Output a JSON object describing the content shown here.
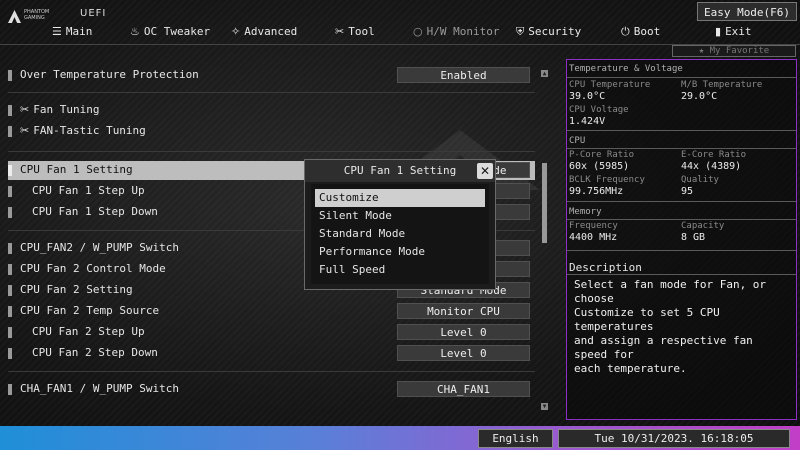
{
  "header": {
    "logo_text": "PHANTOM GAMING",
    "uefi": "UEFI",
    "easy_mode": "Easy Mode(F6)"
  },
  "nav": [
    {
      "label": "Main",
      "icon": "list-icon",
      "glyph": "☰"
    },
    {
      "label": "OC Tweaker",
      "icon": "flame-icon",
      "glyph": "♨"
    },
    {
      "label": "Advanced",
      "icon": "star-icon",
      "glyph": "✧"
    },
    {
      "label": "Tool",
      "icon": "tools-icon",
      "glyph": "✂"
    },
    {
      "label": "H/W Monitor",
      "icon": "monitor-ring-icon",
      "glyph": "○"
    },
    {
      "label": "Security",
      "icon": "shield-icon",
      "glyph": "⛨"
    },
    {
      "label": "Boot",
      "icon": "power-icon",
      "glyph": "⏻"
    },
    {
      "label": "Exit",
      "icon": "exit-icon",
      "glyph": "▮"
    }
  ],
  "settings": [
    {
      "label": "Over Temperature Protection",
      "value": "Enabled"
    },
    {
      "label": "Fan Tuning",
      "value": ""
    },
    {
      "label": "FAN-Tastic Tuning",
      "value": ""
    },
    {
      "label": "CPU Fan 1 Setting",
      "value": "Standard Mode"
    },
    {
      "label": "CPU Fan 1 Step Up",
      "value": ""
    },
    {
      "label": "CPU Fan 1 Step Down",
      "value": ""
    },
    {
      "label": "CPU_FAN2 / W_PUMP Switch",
      "value": ""
    },
    {
      "label": "CPU Fan 2 Control Mode",
      "value": ""
    },
    {
      "label": "CPU Fan 2 Setting",
      "value": "Standard Mode"
    },
    {
      "label": "CPU Fan 2 Temp Source",
      "value": "Monitor CPU"
    },
    {
      "label": "CPU Fan 2 Step Up",
      "value": "Level 0"
    },
    {
      "label": "CPU Fan 2 Step Down",
      "value": "Level 0"
    },
    {
      "label": "CHA_FAN1 / W_PUMP Switch",
      "value": "CHA_FAN1"
    }
  ],
  "popup": {
    "title": "CPU Fan 1 Setting",
    "close": "✕",
    "options": [
      "Customize",
      "Silent Mode",
      "Standard Mode",
      "Performance Mode",
      "Full Speed"
    ],
    "selected": "Customize"
  },
  "favorite": "★ My Favorite",
  "monitor": {
    "temp_header": "Temperature & Voltage",
    "cpu_temp_label": "CPU Temperature",
    "cpu_temp": "39.0°C",
    "mb_temp_label": "M/B Temperature",
    "mb_temp": "29.0°C",
    "cpu_volt_label": "CPU Voltage",
    "cpu_volt": "1.424V",
    "cpu_header": "CPU",
    "pcore_label": "P-Core Ratio",
    "pcore": "60x (5985)",
    "ecore_label": "E-Core Ratio",
    "ecore": "44x (4389)",
    "bclk_label": "BCLK Frequency",
    "bclk": "99.756MHz",
    "quality_label": "Quality",
    "quality": "95",
    "mem_header": "Memory",
    "freq_label": "Frequency",
    "freq": "4400 MHz",
    "cap_label": "Capacity",
    "cap": "8 GB"
  },
  "description": {
    "title": "Description",
    "text": "Select a fan mode for Fan, or choose\nCustomize to set 5 CPU temperatures\nand assign a respective fan speed for\neach temperature."
  },
  "footer": {
    "language": "English",
    "datetime": "Tue 10/31/2023. 16:18:05"
  },
  "colors": {
    "panel_border": "#8c2fc4",
    "highlight": "#bdbdbd",
    "bar_left": "#1f8fd8",
    "bar_right": "#c23ec7"
  }
}
